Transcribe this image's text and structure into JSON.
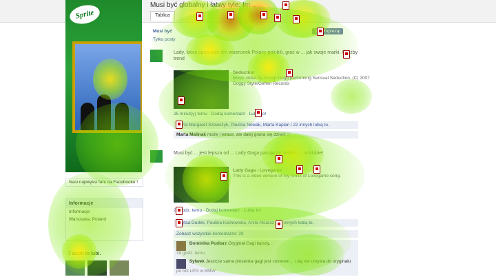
{
  "page": {
    "title": "Musi być globalny i łatwy tyle: Im..."
  },
  "tabs": [
    "Tablica"
  ],
  "filters": {
    "line1": "Musi być",
    "badge": "jest imprezą!",
    "line2": "Tylko posty"
  },
  "sidebar": {
    "brand": "Sprite",
    "fan_text": "Nasi najwięksi fani na Facebooku !",
    "info_header": "Informacje",
    "info_rows": [
      "Informacje",
      "Warszawa, Poland"
    ],
    "likes_header": "7 osób to lubi."
  },
  "posts": [
    {
      "text": "Lady, która sprzedaje ten wizerunek Polacy polubili, grać w ... jak swoje marki. Czyżby trend",
      "media_title": "Seduction",
      "media_desc": "Music video by Snoop Dogg performing Sensual Seduction. (C) 2007 Doggy Style/Geffen Records",
      "meta": "25 minut(y) temu · Dodaj komentarz · Lubię to!",
      "likes": "Marta Margaret Szewczyk, Paulina Nowak, Marta Kaplan i 22 innych lubią to.",
      "comment_author": "Marta Malinak",
      "comment_text": "może i wrace, ale dalej grana się dziwić :)"
    },
    {
      "text": "Musi być ... jest lepsza od ... Lady Gaga pasują do siebie i ... w klubie!",
      "media_title": "Lady Gaga - Lovegame",
      "media_desc": "This is a video version of my remix of Lovegame song.",
      "meta": "23 godz. temu · Dodaj komentarz · Lubię to!",
      "likes": "Edytaa Dudek, Paulina Kalinowska, Anita Alcaraz i 31 innych lubią to.",
      "see_all": "Zobacz wszystkie komentarze: 29",
      "comments": [
        {
          "author": "Dominika Pudlarz",
          "text": "Oryginał Gagi lepszy...",
          "time": "19 godz. temu"
        },
        {
          "author": "Sylwek",
          "text": "Jeszcze sama piosenka gagi jest coverem... i się nie umywa do oryginału",
          "time": "po ból LPG w BMW"
        }
      ]
    }
  ],
  "heat_colors": {
    "hot": "#ff2800",
    "warm": "#ffeb00",
    "cool": "#8ce600"
  }
}
